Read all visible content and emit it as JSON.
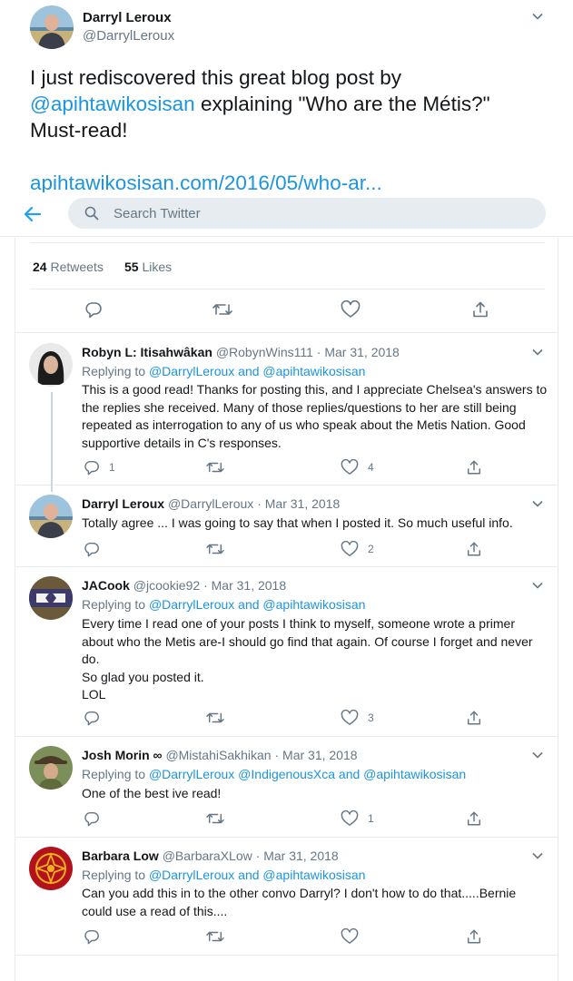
{
  "main_tweet": {
    "author_name": "Darryl Leroux",
    "author_handle": "@DarrylLeroux",
    "text_before": "I just rediscovered this great blog post by ",
    "mention": "@apihtawikosisan",
    "text_after": " explaining \"Who are the Métis?\" Must-read!",
    "link": "apihtawikosisan.com/2016/05/who-ar..."
  },
  "header": {
    "search_placeholder": "Search Twitter"
  },
  "stats": {
    "retweets_count": "24",
    "retweets_label": "Retweets",
    "likes_count": "55",
    "likes_label": "Likes"
  },
  "replies": [
    {
      "name": "Robyn L: Itisahwâkan",
      "handle": "@RobynWins111",
      "date": "Mar 31, 2018",
      "replying_prefix": "Replying to",
      "replying_to": "@DarrylLeroux and @apihtawikosisan",
      "text": "This is a good read! Thanks for posting this, and I appreciate Chelsea's answers to the replies she received. Many of those replies/questions to her are still being repeated as interrogation to any of us who speak about the Metis Nation. Good supportive details in C's responses.",
      "reply_count": "1",
      "retweet_count": "",
      "like_count": "4"
    },
    {
      "name": "Darryl Leroux",
      "handle": "@DarrylLeroux",
      "date": "Mar 31, 2018",
      "replying_prefix": "",
      "replying_to": "",
      "text": "Totally agree ... I was going to say that when I posted it. So much useful info.",
      "reply_count": "",
      "retweet_count": "",
      "like_count": "2"
    },
    {
      "name": "JACook",
      "handle": "@jcookie92",
      "date": "Mar 31, 2018",
      "replying_prefix": "Replying to",
      "replying_to": "@DarrylLeroux and @apihtawikosisan",
      "text_lines": [
        "Every time I read one of your posts I think to myself, someone wrote a primer about who the Metis are-I should go find that again. Of course I forget and never do.",
        "So glad you posted it.",
        "LOL"
      ],
      "reply_count": "",
      "retweet_count": "",
      "like_count": "3"
    },
    {
      "name": "Josh Morin ∞",
      "handle": "@MistahiSakhikan",
      "date": "Mar 31, 2018",
      "replying_prefix": "Replying to",
      "replying_to": "@DarrylLeroux @IndigenousXca and @apihtawikosisan",
      "text": "One of the best ive read!",
      "reply_count": "",
      "retweet_count": "",
      "like_count": "1"
    },
    {
      "name": "Barbara Low",
      "handle": "@BarbaraXLow",
      "date": "Mar 31, 2018",
      "replying_prefix": "Replying to",
      "replying_to": "@DarrylLeroux and @apihtawikosisan",
      "text": "Can you add this in to the other convo Darryl? I don't how to do that.....Bernie could use a read of this....",
      "reply_count": "",
      "retweet_count": "",
      "like_count": ""
    }
  ],
  "separator": "·",
  "colors": {
    "link": "#1b95e0",
    "secondary_text": "#657786",
    "border": "#e6ecf0",
    "search_bg": "#e6ecf0"
  }
}
